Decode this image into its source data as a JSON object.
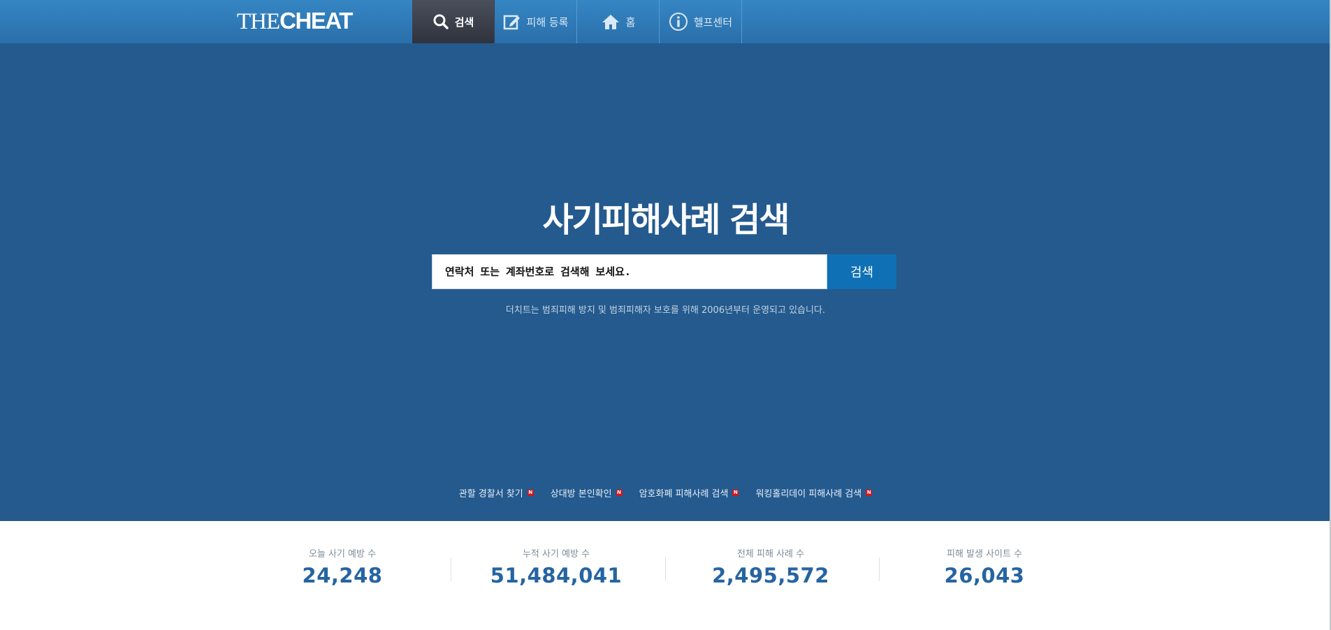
{
  "header": {
    "logo_light": "THE",
    "logo_bold": "CHEAT",
    "nav": [
      {
        "label": "검색",
        "icon": "search-icon",
        "active": true
      },
      {
        "label": "피해 등록",
        "icon": "edit-icon",
        "active": false
      },
      {
        "label": "홈",
        "icon": "home-icon",
        "active": false
      },
      {
        "label": "헬프센터",
        "icon": "info-icon",
        "active": false
      }
    ]
  },
  "hero": {
    "title": "사기피해사례 검색",
    "search_placeholder": "연락처 또는 계좌번호로 검색해 보세요.",
    "search_button": "검색",
    "subtitle": "더치트는 범죄피해 방지 및 범죄피해자 보호를 위해 2006년부터 운영되고 있습니다.",
    "quick_links": [
      {
        "label": "관할 경찰서 찾기",
        "badge": "N"
      },
      {
        "label": "상대방 본인확인",
        "badge": "N"
      },
      {
        "label": "암호화폐 피해사례 검색",
        "badge": "N"
      },
      {
        "label": "워킹홀리데이 피해사례 검색",
        "badge": "N"
      }
    ]
  },
  "stats": [
    {
      "label": "오늘 사기 예방 수",
      "value": "24,248"
    },
    {
      "label": "누적 사기 예방 수",
      "value": "51,484,041"
    },
    {
      "label": "전체 피해 사례 수",
      "value": "2,495,572"
    },
    {
      "label": "피해 발생 사이트 수",
      "value": "26,043"
    }
  ],
  "colors": {
    "topbar": "#2f7bbb",
    "hero_bg": "#245a8e",
    "button": "#1070b5",
    "stat_value": "#2664a2",
    "badge": "#d2161e"
  }
}
